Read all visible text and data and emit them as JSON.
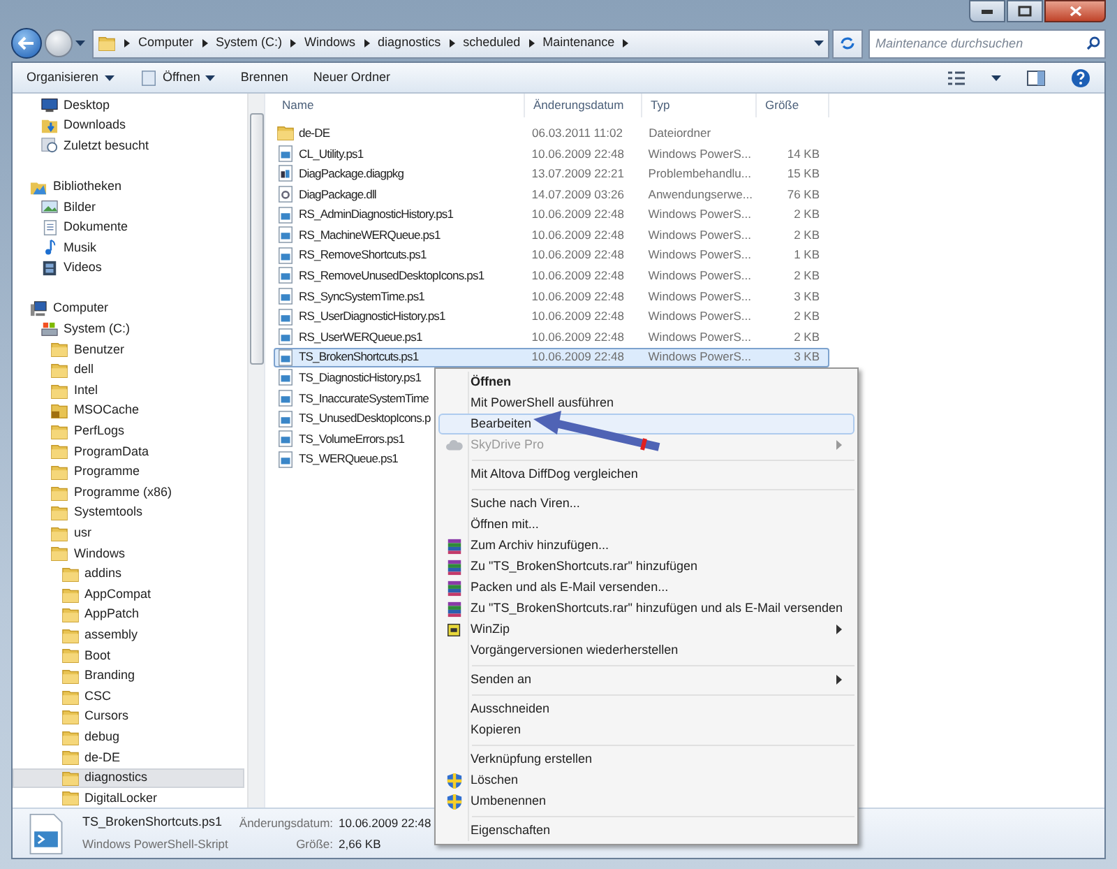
{
  "address": {
    "crumbs": [
      "Computer",
      "System (C:)",
      "Windows",
      "diagnostics",
      "scheduled",
      "Maintenance"
    ]
  },
  "search": {
    "placeholder": "Maintenance durchsuchen"
  },
  "toolbar": [
    {
      "label": "Organisieren",
      "dropdown": true
    },
    {
      "label": "Öffnen",
      "dropdown": true
    },
    {
      "label": "Brennen",
      "dropdown": false
    },
    {
      "label": "Neuer Ordner",
      "dropdown": false
    }
  ],
  "nav": {
    "sections": [
      {
        "items": [
          {
            "label": "Desktop",
            "kind": "desktop",
            "selected": false
          },
          {
            "label": "Downloads",
            "kind": "download",
            "selected": false
          },
          {
            "label": "Zuletzt besucht",
            "kind": "recent",
            "selected": false
          }
        ]
      },
      {
        "header": {
          "label": "Bibliotheken",
          "kind": "library",
          "selected": false
        },
        "items": [
          {
            "label": "Bilder",
            "kind": "pictures",
            "selected": false
          },
          {
            "label": "Dokumente",
            "kind": "documents",
            "selected": false
          },
          {
            "label": "Musik",
            "kind": "music",
            "selected": false
          },
          {
            "label": "Videos",
            "kind": "videos",
            "selected": false
          }
        ]
      },
      {
        "header": {
          "label": "Computer",
          "kind": "computer",
          "selected": false
        },
        "items": [
          {
            "label": "System (C:)",
            "kind": "drive",
            "selected": false,
            "children": [
              {
                "label": "Benutzer",
                "kind": "folder",
                "selected": false
              },
              {
                "label": "dell",
                "kind": "folder",
                "selected": false
              },
              {
                "label": "Intel",
                "kind": "folder",
                "selected": false
              },
              {
                "label": "MSOCache",
                "kind": "locked",
                "selected": false
              },
              {
                "label": "PerfLogs",
                "kind": "folder",
                "selected": false
              },
              {
                "label": "ProgramData",
                "kind": "folder",
                "selected": false
              },
              {
                "label": "Programme",
                "kind": "folder",
                "selected": false
              },
              {
                "label": "Programme (x86)",
                "kind": "folder",
                "selected": false
              },
              {
                "label": "Systemtools",
                "kind": "folder",
                "selected": false
              },
              {
                "label": "usr",
                "kind": "folder",
                "selected": false
              },
              {
                "label": "Windows",
                "kind": "folder",
                "selected": false,
                "children": [
                  {
                    "label": "addins",
                    "kind": "folder",
                    "selected": false
                  },
                  {
                    "label": "AppCompat",
                    "kind": "folder",
                    "selected": false
                  },
                  {
                    "label": "AppPatch",
                    "kind": "folder",
                    "selected": false
                  },
                  {
                    "label": "assembly",
                    "kind": "folder",
                    "selected": false
                  },
                  {
                    "label": "Boot",
                    "kind": "folder",
                    "selected": false
                  },
                  {
                    "label": "Branding",
                    "kind": "folder",
                    "selected": false
                  },
                  {
                    "label": "CSC",
                    "kind": "folder",
                    "selected": false
                  },
                  {
                    "label": "Cursors",
                    "kind": "folder",
                    "selected": false
                  },
                  {
                    "label": "debug",
                    "kind": "folder",
                    "selected": false
                  },
                  {
                    "label": "de-DE",
                    "kind": "folder",
                    "selected": false
                  },
                  {
                    "label": "diagnostics",
                    "kind": "folder",
                    "selected": true
                  },
                  {
                    "label": "DigitalLocker",
                    "kind": "folder",
                    "selected": false
                  }
                ]
              }
            ]
          }
        ]
      }
    ]
  },
  "table": {
    "columns": [
      "Name",
      "Änderungsdatum",
      "Typ",
      "Größe"
    ],
    "rows": [
      {
        "kind": "folder",
        "name": "de-DE",
        "date": "06.03.2011 11:02",
        "type": "Dateiordner",
        "selected": false
      },
      {
        "kind": "script",
        "name": "CL_Utility.ps1",
        "date": "10.06.2009 22:48",
        "type": "Windows PowerS...",
        "size": "14 KB",
        "selected": false
      },
      {
        "kind": "package",
        "name": "DiagPackage.diagpkg",
        "date": "13.07.2009 22:21",
        "type": "Problembehandlu...",
        "size": "15 KB",
        "selected": false
      },
      {
        "kind": "dll",
        "name": "DiagPackage.dll",
        "date": "14.07.2009 03:26",
        "type": "Anwendungserwe...",
        "size": "76 KB",
        "selected": false
      },
      {
        "kind": "script",
        "name": "RS_AdminDiagnosticHistory.ps1",
        "date": "10.06.2009 22:48",
        "type": "Windows PowerS...",
        "size": "2 KB",
        "selected": false
      },
      {
        "kind": "script",
        "name": "RS_MachineWERQueue.ps1",
        "date": "10.06.2009 22:48",
        "type": "Windows PowerS...",
        "size": "2 KB",
        "selected": false
      },
      {
        "kind": "script",
        "name": "RS_RemoveShortcuts.ps1",
        "date": "10.06.2009 22:48",
        "type": "Windows PowerS...",
        "size": "1 KB",
        "selected": false
      },
      {
        "kind": "script",
        "name": "RS_RemoveUnusedDesktopIcons.ps1",
        "date": "10.06.2009 22:48",
        "type": "Windows PowerS...",
        "size": "2 KB",
        "selected": false
      },
      {
        "kind": "script",
        "name": "RS_SyncSystemTime.ps1",
        "date": "10.06.2009 22:48",
        "type": "Windows PowerS...",
        "size": "3 KB",
        "selected": false
      },
      {
        "kind": "script",
        "name": "RS_UserDiagnosticHistory.ps1",
        "date": "10.06.2009 22:48",
        "type": "Windows PowerS...",
        "size": "2 KB",
        "selected": false
      },
      {
        "kind": "script",
        "name": "RS_UserWERQueue.ps1",
        "date": "10.06.2009 22:48",
        "type": "Windows PowerS...",
        "size": "2 KB",
        "selected": false
      },
      {
        "kind": "script",
        "name": "TS_BrokenShortcuts.ps1",
        "date": "10.06.2009 22:48",
        "type": "Windows PowerS...",
        "size": "3 KB",
        "selected": true
      },
      {
        "kind": "script",
        "name": "TS_DiagnosticHistory.ps1",
        "selected": false
      },
      {
        "kind": "script",
        "name": "TS_InaccurateSystemTime",
        "selected": false
      },
      {
        "kind": "script",
        "name": "TS_UnusedDesktopIcons.p",
        "selected": false
      },
      {
        "kind": "script",
        "name": "TS_VolumeErrors.ps1",
        "selected": false
      },
      {
        "kind": "script",
        "name": "TS_WERQueue.ps1",
        "selected": false
      }
    ]
  },
  "context_menu": {
    "items": [
      {
        "kind": "plain",
        "label": "Öffnen",
        "bold": true,
        "disabled": false,
        "selected": false,
        "submenu": false
      },
      {
        "kind": "plain",
        "label": "Mit PowerShell ausführen",
        "bold": false,
        "disabled": false,
        "selected": false,
        "submenu": false
      },
      {
        "kind": "plain",
        "label": "Bearbeiten",
        "bold": false,
        "disabled": false,
        "selected": true,
        "submenu": false
      },
      {
        "kind": "cloud",
        "label": "SkyDrive Pro",
        "bold": false,
        "disabled": true,
        "selected": false,
        "submenu": true
      },
      {
        "kind": "separator"
      },
      {
        "kind": "plain",
        "label": "Mit Altova DiffDog vergleichen",
        "bold": false,
        "disabled": false,
        "selected": false,
        "submenu": false
      },
      {
        "kind": "separator"
      },
      {
        "kind": "plain",
        "label": "Suche nach Viren...",
        "bold": false,
        "disabled": false,
        "selected": false,
        "submenu": false
      },
      {
        "kind": "plain",
        "label": "Öffnen mit...",
        "bold": false,
        "disabled": false,
        "selected": false,
        "submenu": false
      },
      {
        "kind": "archive",
        "label": "Zum Archiv hinzufügen...",
        "bold": false,
        "disabled": false,
        "selected": false,
        "submenu": false
      },
      {
        "kind": "archive",
        "label": "Zu \"TS_BrokenShortcuts.rar\" hinzufügen",
        "bold": false,
        "disabled": false,
        "selected": false,
        "submenu": false
      },
      {
        "kind": "archive",
        "label": "Packen und als E-Mail versenden...",
        "bold": false,
        "disabled": false,
        "selected": false,
        "submenu": false
      },
      {
        "kind": "archive",
        "label": "Zu \"TS_BrokenShortcuts.rar\" hinzufügen und als E-Mail versenden",
        "bold": false,
        "disabled": false,
        "selected": false,
        "submenu": false
      },
      {
        "kind": "winzip",
        "label": "WinZip",
        "bold": false,
        "disabled": false,
        "selected": false,
        "submenu": true
      },
      {
        "kind": "plain",
        "label": "Vorgängerversionen wiederherstellen",
        "bold": false,
        "disabled": false,
        "selected": false,
        "submenu": false
      },
      {
        "kind": "separator"
      },
      {
        "kind": "plain",
        "label": "Senden an",
        "bold": false,
        "disabled": false,
        "selected": false,
        "submenu": true
      },
      {
        "kind": "separator"
      },
      {
        "kind": "plain",
        "label": "Ausschneiden",
        "bold": false,
        "disabled": false,
        "selected": false,
        "submenu": false
      },
      {
        "kind": "plain",
        "label": "Kopieren",
        "bold": false,
        "disabled": false,
        "selected": false,
        "submenu": false
      },
      {
        "kind": "separator"
      },
      {
        "kind": "plain",
        "label": "Verknüpfung erstellen",
        "bold": false,
        "disabled": false,
        "selected": false,
        "submenu": false
      },
      {
        "kind": "shield",
        "label": "Löschen",
        "bold": false,
        "disabled": false,
        "selected": false,
        "submenu": false
      },
      {
        "kind": "shield",
        "label": "Umbenennen",
        "bold": false,
        "disabled": false,
        "selected": false,
        "submenu": false
      },
      {
        "kind": "separator"
      },
      {
        "kind": "plain",
        "label": "Eigenschaften",
        "bold": false,
        "disabled": false,
        "selected": false,
        "submenu": false
      }
    ]
  },
  "details": {
    "name": "TS_BrokenShortcuts.ps1",
    "type": "Windows PowerShell-Skript",
    "fields": [
      {
        "label": "Änderungsdatum:",
        "value": "10.06.2009 22:48"
      },
      {
        "label": "Größe:",
        "value": "2,66 KB"
      }
    ]
  }
}
